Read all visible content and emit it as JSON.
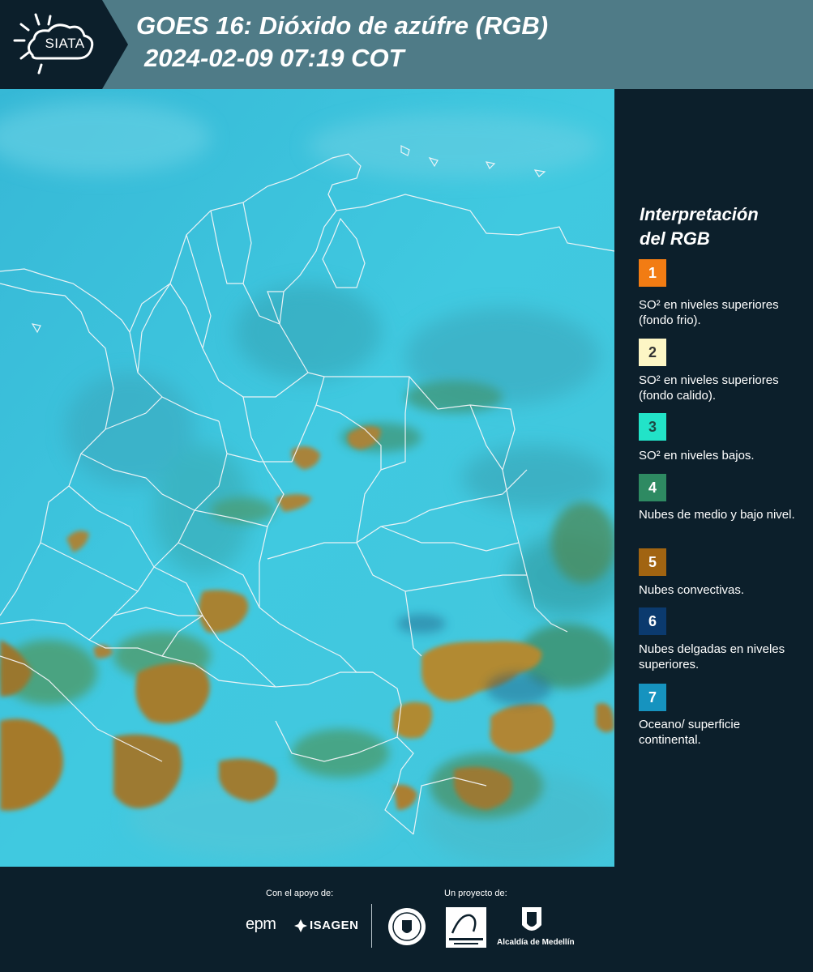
{
  "header": {
    "logo_text": "SIATA",
    "title": "GOES 16: Dióxido de azúfre (RGB)",
    "subtitle": "2024-02-09 07:19 COT"
  },
  "legend": {
    "title_line1": "Interpretación",
    "title_line2": "del RGB",
    "items": [
      {
        "number": "1",
        "color": "#f27c13",
        "text_color": "#ffffff",
        "label": "SO² en niveles superiores (fondo frio)."
      },
      {
        "number": "2",
        "color": "#fdf6c5",
        "text_color": "#333333",
        "label": "SO² en niveles superiores (fondo calido)."
      },
      {
        "number": "3",
        "color": "#22e3c8",
        "text_color": "#1d4a46",
        "label": "SO² en niveles bajos."
      },
      {
        "number": "4",
        "color": "#2e8a62",
        "text_color": "#ffffff",
        "label": "Nubes de medio y bajo nivel."
      },
      {
        "number": "5",
        "color": "#a16411",
        "text_color": "#ffffff",
        "label": "Nubes convectivas."
      },
      {
        "number": "6",
        "color": "#0b3a6e",
        "text_color": "#ffffff",
        "label": "Nubes delgadas en niveles superiores."
      },
      {
        "number": "7",
        "color": "#1693bf",
        "text_color": "#ffffff",
        "label": "Oceano/ superficie continental."
      }
    ]
  },
  "footer": {
    "support_label": "Con el apoyo de:",
    "project_label": "Un proyecto de:",
    "epm": "epm",
    "isagen": "ISAGEN",
    "alcaldia": "Alcaldía de Medellín"
  }
}
